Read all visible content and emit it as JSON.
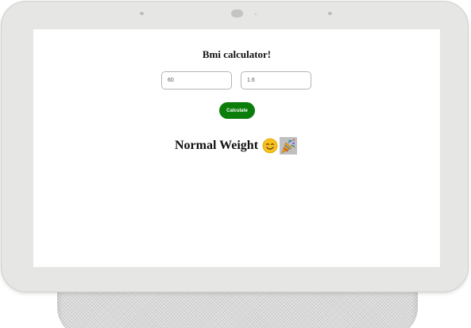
{
  "app": {
    "title": "Bmi calculator!"
  },
  "form": {
    "weight_value": "60",
    "height_value": "1.6",
    "calculate_label": "Calculate"
  },
  "result": {
    "text": "Normal Weight",
    "icons": [
      "smiling-face-icon",
      "party-popper-icon"
    ]
  },
  "colors": {
    "button": "#0b7d0b",
    "bezel": "#e6e6e4",
    "screen": "#ffffff"
  }
}
